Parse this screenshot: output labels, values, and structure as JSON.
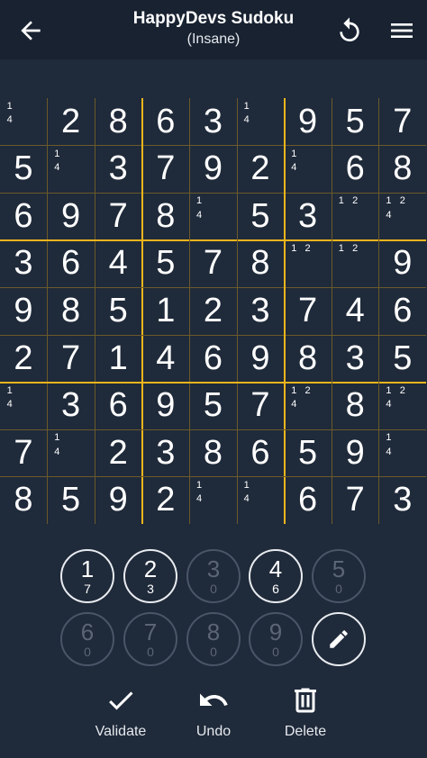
{
  "header": {
    "title": "HappyDevs Sudoku",
    "difficulty": "(Insane)",
    "back_icon": "arrow-left-icon",
    "refresh_icon": "restart-icon",
    "menu_icon": "menu-icon"
  },
  "colors": {
    "background": "#1f2a3a",
    "header": "#182231",
    "thin_grid": "#6b5a2a",
    "thick_grid": "#f2b51c",
    "disabled": "#4a5568"
  },
  "board": {
    "rows": [
      [
        "",
        "2",
        "8",
        "6",
        "3",
        "",
        "9",
        "5",
        "7"
      ],
      [
        "5",
        "",
        "3",
        "7",
        "9",
        "2",
        "",
        "6",
        "8"
      ],
      [
        "6",
        "9",
        "7",
        "8",
        "",
        "5",
        "3",
        "",
        ""
      ],
      [
        "3",
        "6",
        "4",
        "5",
        "7",
        "8",
        "",
        "",
        "9"
      ],
      [
        "9",
        "8",
        "5",
        "1",
        "2",
        "3",
        "7",
        "4",
        "6"
      ],
      [
        "2",
        "7",
        "1",
        "4",
        "6",
        "9",
        "8",
        "3",
        "5"
      ],
      [
        "",
        "3",
        "6",
        "9",
        "5",
        "7",
        "",
        "8",
        ""
      ],
      [
        "7",
        "",
        "2",
        "3",
        "8",
        "6",
        "5",
        "9",
        ""
      ],
      [
        "8",
        "5",
        "9",
        "2",
        "",
        "",
        "6",
        "7",
        "3"
      ]
    ],
    "notes": [
      [
        [
          "1",
          "4"
        ],
        [],
        [],
        [],
        [],
        [
          "1",
          "4"
        ],
        [],
        [],
        []
      ],
      [
        [],
        [
          "1",
          "4"
        ],
        [],
        [],
        [],
        [],
        [
          "1",
          "4"
        ],
        [],
        []
      ],
      [
        [],
        [],
        [],
        [],
        [
          "1",
          "4"
        ],
        [],
        [],
        [
          "1",
          "2"
        ],
        [
          "1",
          "2",
          "4"
        ]
      ],
      [
        [],
        [],
        [],
        [],
        [],
        [],
        [
          "1",
          "2"
        ],
        [
          "1",
          "2"
        ],
        []
      ],
      [
        [],
        [],
        [],
        [],
        [],
        [],
        [],
        [],
        []
      ],
      [
        [],
        [],
        [],
        [],
        [],
        [],
        [],
        [],
        []
      ],
      [
        [
          "1",
          "4"
        ],
        [],
        [],
        [],
        [],
        [],
        [
          "1",
          "2",
          "4"
        ],
        [],
        [
          "1",
          "2",
          "4"
        ]
      ],
      [
        [],
        [
          "1",
          "4"
        ],
        [],
        [],
        [],
        [],
        [],
        [],
        [
          "1",
          "4"
        ]
      ],
      [
        [],
        [],
        [],
        [],
        [
          "1",
          "4"
        ],
        [
          "1",
          "4"
        ],
        [],
        [],
        []
      ]
    ]
  },
  "numpad": [
    {
      "digit": "1",
      "remaining": "7",
      "enabled": true
    },
    {
      "digit": "2",
      "remaining": "3",
      "enabled": true
    },
    {
      "digit": "3",
      "remaining": "0",
      "enabled": false
    },
    {
      "digit": "4",
      "remaining": "6",
      "enabled": true
    },
    {
      "digit": "5",
      "remaining": "0",
      "enabled": false
    },
    {
      "digit": "6",
      "remaining": "0",
      "enabled": false
    },
    {
      "digit": "7",
      "remaining": "0",
      "enabled": false
    },
    {
      "digit": "8",
      "remaining": "0",
      "enabled": false
    },
    {
      "digit": "9",
      "remaining": "0",
      "enabled": false
    }
  ],
  "pencil_icon": "pencil-icon",
  "actions": {
    "validate": "Validate",
    "undo": "Undo",
    "delete": "Delete"
  }
}
